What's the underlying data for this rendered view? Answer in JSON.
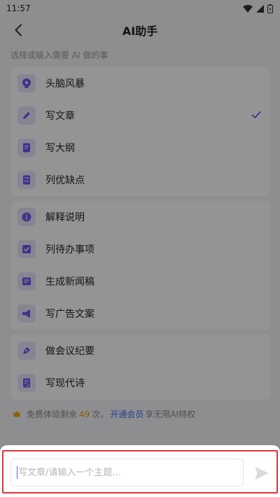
{
  "status_bar": {
    "time": "11:57"
  },
  "header": {
    "title": "AI助手"
  },
  "hint": "选择或输入需要 AI 做的事",
  "groups": [
    {
      "items": [
        {
          "label": "头脑风暴",
          "icon": "brain-icon"
        },
        {
          "label": "写文章",
          "icon": "pencil-icon",
          "selected": true
        },
        {
          "label": "写大纲",
          "icon": "outline-doc-icon"
        },
        {
          "label": "列优缺点",
          "icon": "checklist-icon"
        }
      ]
    },
    {
      "items": [
        {
          "label": "解释说明",
          "icon": "info-icon"
        },
        {
          "label": "列待办事项",
          "icon": "checkbox-icon"
        },
        {
          "label": "生成新闻稿",
          "icon": "news-icon"
        },
        {
          "label": "写广告文案",
          "icon": "megaphone-icon"
        }
      ]
    },
    {
      "items": [
        {
          "label": "做会议纪要",
          "icon": "pen-nib-icon"
        },
        {
          "label": "写现代诗",
          "icon": "poem-doc-icon"
        }
      ]
    }
  ],
  "quota": {
    "prefix": "免费体验剩余",
    "count": "49",
    "unit": "次，",
    "vip_link": "开通会员",
    "suffix": "享无限AI特权"
  },
  "input": {
    "placeholder": "写文章/请输入一个主题...",
    "value": ""
  },
  "colors": {
    "accent": "#6c5cf0",
    "icon_bg": "#e8e5fb",
    "vip_blue": "#4a6cf7",
    "count_orange": "#f0a000",
    "highlight_red": "#e0313e"
  }
}
